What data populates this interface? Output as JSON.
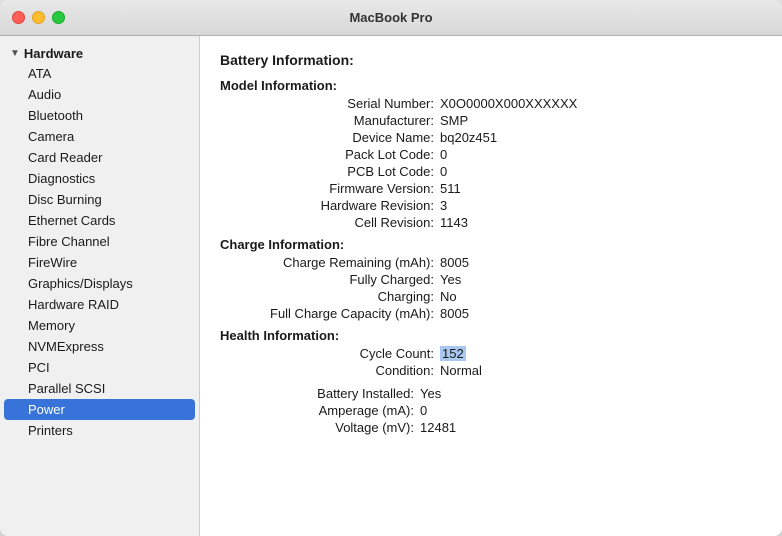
{
  "window": {
    "title": "MacBook Pro"
  },
  "sidebar": {
    "section_label": "Hardware",
    "items": [
      {
        "label": "ATA",
        "selected": false
      },
      {
        "label": "Audio",
        "selected": false
      },
      {
        "label": "Bluetooth",
        "selected": false
      },
      {
        "label": "Camera",
        "selected": false
      },
      {
        "label": "Card Reader",
        "selected": false
      },
      {
        "label": "Diagnostics",
        "selected": false
      },
      {
        "label": "Disc Burning",
        "selected": false
      },
      {
        "label": "Ethernet Cards",
        "selected": false
      },
      {
        "label": "Fibre Channel",
        "selected": false
      },
      {
        "label": "FireWire",
        "selected": false
      },
      {
        "label": "Graphics/Displays",
        "selected": false
      },
      {
        "label": "Hardware RAID",
        "selected": false
      },
      {
        "label": "Memory",
        "selected": false
      },
      {
        "label": "NVMExpress",
        "selected": false
      },
      {
        "label": "PCI",
        "selected": false
      },
      {
        "label": "Parallel SCSI",
        "selected": false
      },
      {
        "label": "Power",
        "selected": true
      },
      {
        "label": "Printers",
        "selected": false
      }
    ]
  },
  "main": {
    "title": "Battery Information:",
    "sections": [
      {
        "label": "Model Information:",
        "rows": [
          {
            "label": "Serial Number:",
            "value": "X0O0000X000XXXXXX",
            "indent": true,
            "highlight": false
          },
          {
            "label": "Manufacturer:",
            "value": "SMP",
            "indent": true,
            "highlight": false
          },
          {
            "label": "Device Name:",
            "value": "bq20z451",
            "indent": true,
            "highlight": false
          },
          {
            "label": "Pack Lot Code:",
            "value": "0",
            "indent": true,
            "highlight": false
          },
          {
            "label": "PCB Lot Code:",
            "value": "0",
            "indent": true,
            "highlight": false
          },
          {
            "label": "Firmware Version:",
            "value": "511",
            "indent": true,
            "highlight": false
          },
          {
            "label": "Hardware Revision:",
            "value": "3",
            "indent": true,
            "highlight": false
          },
          {
            "label": "Cell Revision:",
            "value": "1143",
            "indent": true,
            "highlight": false
          }
        ]
      },
      {
        "label": "Charge Information:",
        "rows": [
          {
            "label": "Charge Remaining (mAh):",
            "value": "8005",
            "indent": true,
            "highlight": false
          },
          {
            "label": "Fully Charged:",
            "value": "Yes",
            "indent": true,
            "highlight": false
          },
          {
            "label": "Charging:",
            "value": "No",
            "indent": true,
            "highlight": false
          },
          {
            "label": "Full Charge Capacity (mAh):",
            "value": "8005",
            "indent": true,
            "highlight": false
          }
        ]
      },
      {
        "label": "Health Information:",
        "rows": [
          {
            "label": "Cycle Count:",
            "value": "152",
            "indent": true,
            "highlight": true
          },
          {
            "label": "Condition:",
            "value": "Normal",
            "indent": true,
            "highlight": false
          }
        ]
      },
      {
        "label": "",
        "rows": [
          {
            "label": "Battery Installed:",
            "value": "Yes",
            "indent": false,
            "highlight": false
          },
          {
            "label": "Amperage (mA):",
            "value": "0",
            "indent": false,
            "highlight": false
          },
          {
            "label": "Voltage (mV):",
            "value": "12481",
            "indent": false,
            "highlight": false
          }
        ]
      }
    ]
  }
}
